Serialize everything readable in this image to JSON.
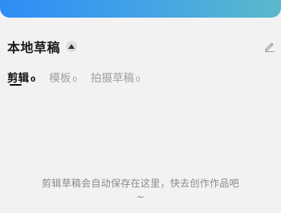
{
  "section": {
    "title": "本地草稿"
  },
  "tabs": [
    {
      "label": "剪辑",
      "count": "0",
      "active": true
    },
    {
      "label": "模板",
      "count": "0",
      "active": false
    },
    {
      "label": "拍摄草稿",
      "count": "0",
      "active": false
    }
  ],
  "empty_state": {
    "line1": "剪辑草稿会自动保存在这里，快去创作作品吧",
    "line2": "~"
  },
  "colors": {
    "banner_start": "#2f8cf4",
    "banner_end": "#5cb9c9",
    "background": "#f2f2f3"
  },
  "icons": {
    "toggle": "triangle-up-icon",
    "edit": "pencil-icon"
  }
}
